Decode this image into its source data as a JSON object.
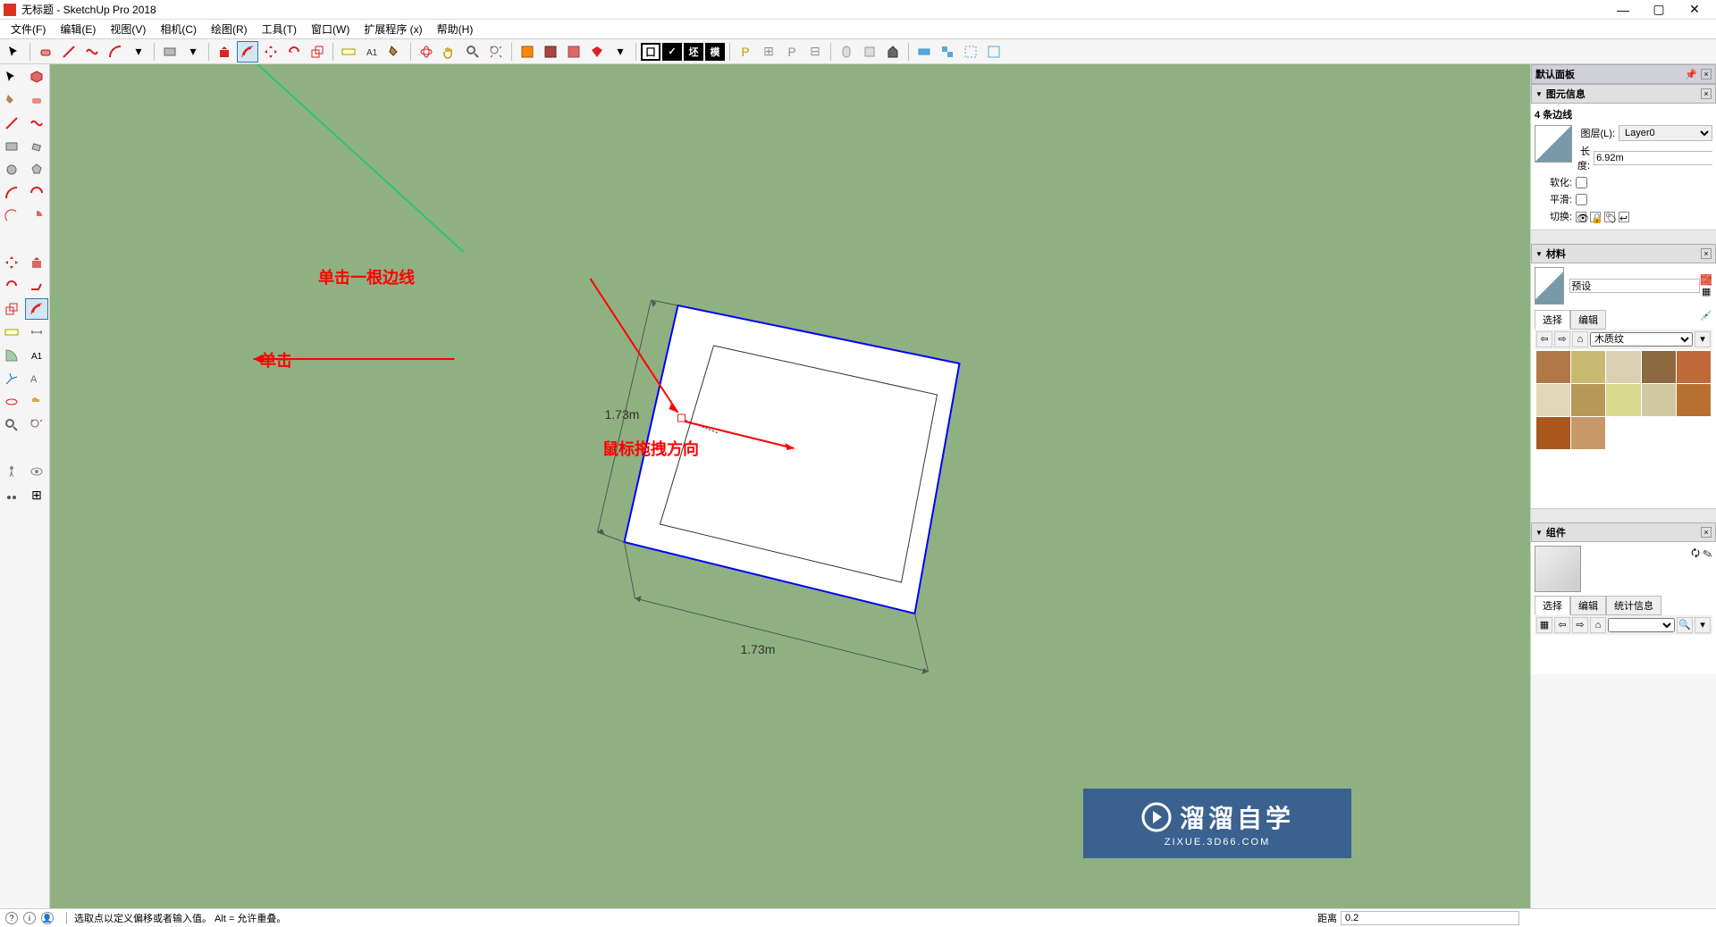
{
  "title": "无标题 - SketchUp Pro 2018",
  "menus": [
    "文件(F)",
    "编辑(E)",
    "视图(V)",
    "相机(C)",
    "绘图(R)",
    "工具(T)",
    "窗口(W)",
    "扩展程序 (x)",
    "帮助(H)"
  ],
  "panel": {
    "tray_title": "默认面板",
    "entity": {
      "title": "图元信息",
      "selection": "4 条边线",
      "layer_lbl": "图层(L):",
      "layer_val": "Layer0",
      "length_lbl": "长度:",
      "length_val": "6.92m",
      "soft_lbl": "软化:",
      "smooth_lbl": "平滑:",
      "toggle_lbl": "切换:"
    },
    "material": {
      "title": "材料",
      "preset": "预设",
      "tab_select": "选择",
      "tab_edit": "编辑",
      "category": "木质纹"
    },
    "component": {
      "title": "组件",
      "tab1": "选择",
      "tab2": "编辑",
      "tab3": "统计信息"
    }
  },
  "annotations": {
    "click_edge": "单击一根边线",
    "drag_dir": "鼠标拖拽方向",
    "click": "单击"
  },
  "dims": {
    "d1": "1.73m",
    "d2": "1.73m"
  },
  "status": {
    "hint": "选取点以定义偏移或者输入值。 Alt = 允许重叠。",
    "dist_lbl": "距离",
    "dist_val": "0.2"
  },
  "watermark": {
    "top": "溜溜自学",
    "bot": "ZIXUE.3D66.COM"
  },
  "sq": [
    "囗",
    "✓",
    "坯",
    "模"
  ]
}
